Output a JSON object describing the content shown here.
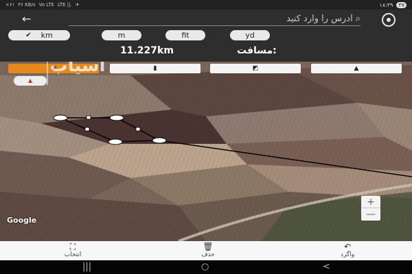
{
  "status_bar": {
    "left": [
      "×۶۱",
      "۴۶ KB/s",
      "Vo LTE",
      "LTE ||.",
      "✈"
    ],
    "time": "۱۸:۳۹",
    "battery": "۳۷"
  },
  "header": {
    "back_icon": "arrow-left-icon",
    "search_placeholder": "آدرس را وارد کنید",
    "locate_icon": "my-location-icon"
  },
  "units": {
    "items": [
      "km",
      "m",
      "fit",
      "yd"
    ],
    "selected": "km"
  },
  "distance": {
    "label": "مسافت:",
    "value": "11.227km"
  },
  "map_types": {
    "items": [
      "satellite-icon",
      "map-icon",
      "terrain-icon",
      "mountain-icon"
    ],
    "active_index": 0
  },
  "watermark": "آسیاب",
  "map": {
    "provider": "Google",
    "zoom_in": "+",
    "zoom_out": "—"
  },
  "bottom_bar": {
    "select_label": "انتخاب",
    "delete_label": "حذف",
    "undo_label": "واگرد"
  },
  "system_nav": [
    "|||",
    "○",
    "<"
  ],
  "colors": {
    "accent": "#e5891c",
    "panel": "#2e2e2e"
  }
}
